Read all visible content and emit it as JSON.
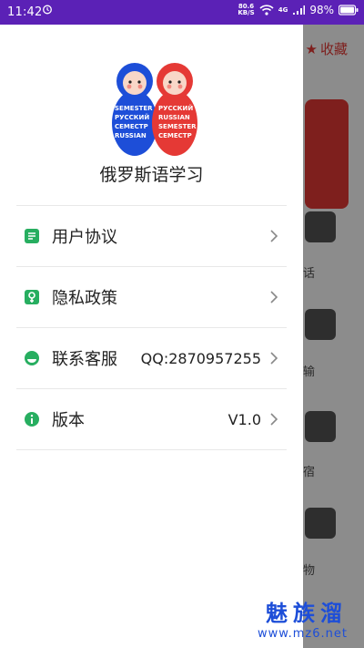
{
  "status": {
    "time": "11:42",
    "net_top": "80.6",
    "net_bottom": "KB/S",
    "signal": "4G",
    "battery": "98%"
  },
  "background": {
    "favorite_label": "收藏",
    "labels": [
      "话",
      "输",
      "宿",
      "物"
    ]
  },
  "drawer": {
    "app_name": "俄罗斯语学习",
    "logo_text": [
      "SEMESTER",
      "РУССКИЙ",
      "СЕМЕСТР",
      "RUSSIAN"
    ],
    "menu": [
      {
        "label": "用户协议",
        "value": "",
        "icon": "document-icon"
      },
      {
        "label": "隐私政策",
        "value": "",
        "icon": "privacy-icon"
      },
      {
        "label": "联系客服",
        "value": "QQ:2870957255",
        "icon": "support-icon"
      },
      {
        "label": "版本",
        "value": "V1.0",
        "icon": "info-icon"
      }
    ]
  },
  "watermark": {
    "cn": "魅族溜",
    "url": "www.mz6.net"
  },
  "colors": {
    "accent": "#27ae60",
    "status_bar": "#5b21b6",
    "red": "#e53935"
  }
}
